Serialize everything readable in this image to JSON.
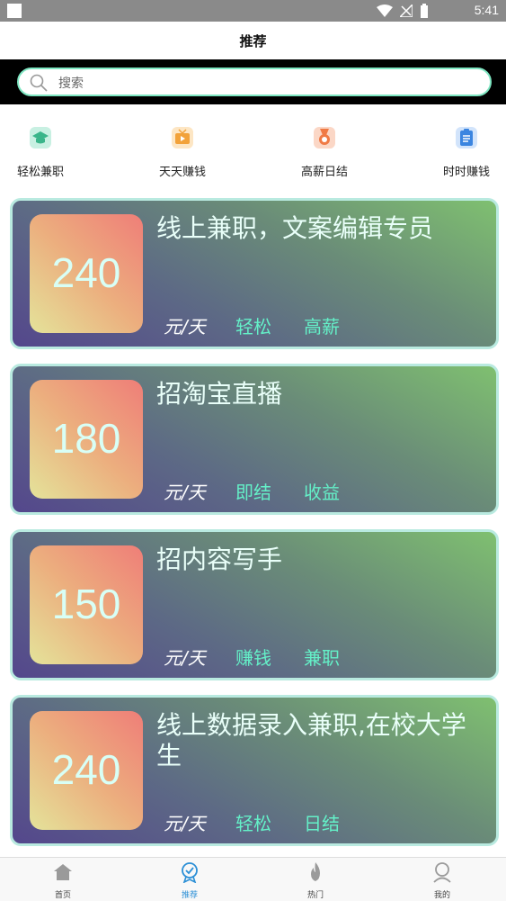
{
  "status_bar": {
    "time": "5:41"
  },
  "header": {
    "title": "推荐"
  },
  "search": {
    "placeholder": "搜索"
  },
  "categories": [
    {
      "label": "轻松兼职",
      "icon": "graduation-cap-icon"
    },
    {
      "label": "天天赚钱",
      "icon": "tv-icon"
    },
    {
      "label": "高薪日结",
      "icon": "medal-icon"
    },
    {
      "label": "时时赚钱",
      "icon": "clipboard-icon"
    }
  ],
  "jobs": [
    {
      "pay": "240",
      "title": "线上兼职，文案编辑专员",
      "unit": "元/天",
      "tags": [
        "轻松",
        "高薪"
      ]
    },
    {
      "pay": "180",
      "title": "招淘宝直播",
      "unit": "元/天",
      "tags": [
        "即结",
        "收益"
      ]
    },
    {
      "pay": "150",
      "title": "招内容写手",
      "unit": "元/天",
      "tags": [
        "赚钱",
        "兼职"
      ]
    },
    {
      "pay": "240",
      "title": "线上数据录入兼职,在校大学生",
      "unit": "元/天",
      "tags": [
        "轻松",
        "日结"
      ]
    }
  ],
  "tabbar": [
    {
      "label": "首页",
      "icon": "home-icon",
      "active": false
    },
    {
      "label": "推荐",
      "icon": "recommend-icon",
      "active": true
    },
    {
      "label": "热门",
      "icon": "fire-icon",
      "active": false
    },
    {
      "label": "我的",
      "icon": "user-icon",
      "active": false
    }
  ],
  "colors": {
    "accent": "#64f0c8",
    "active_tab": "#2b8fd6",
    "card_border": "#b9eae0"
  }
}
